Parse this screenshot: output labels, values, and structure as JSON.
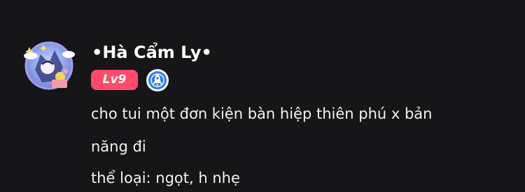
{
  "comment": {
    "username": "•Hà Cẩm Ly•",
    "level_badge": "Lv9",
    "verified_badge_icon": "blue-shield-rocket-icon",
    "message_lines": [
      "cho tui một đơn kiện bàn hiệp thiên phú x bản",
      "năng đi",
      "thể loại: ngọt, h nhẹ"
    ]
  },
  "colors": {
    "background": "#161517",
    "level_badge": "#fe4b6b",
    "shield_badge": "#2f7cf6"
  }
}
